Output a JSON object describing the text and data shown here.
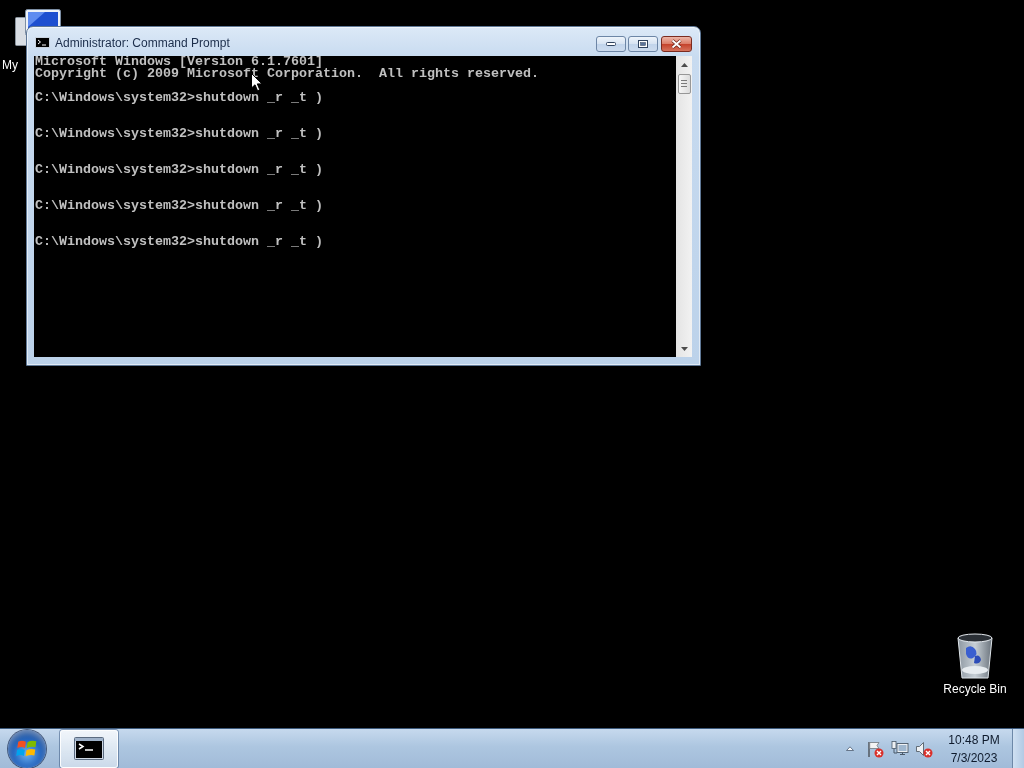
{
  "desktop": {
    "computer_icon": {
      "label": "My"
    },
    "recycle_bin": {
      "label": "Recycle Bin"
    }
  },
  "window": {
    "title": "Administrator: Command Prompt",
    "banner": [
      "Microsoft Windows [Version 6.1.7601]",
      "Copyright (c) 2009 Microsoft Corporation.  All rights reserved."
    ],
    "commands": [
      "C:\\Windows\\system32>shutdown _r _t )",
      "C:\\Windows\\system32>shutdown _r _t )",
      "C:\\Windows\\system32>shutdown _r _t )",
      "C:\\Windows\\system32>shutdown _r _t )",
      "C:\\Windows\\system32>shutdown _r _t )"
    ]
  },
  "taskbar": {
    "buttons": [
      {
        "kind": "console",
        "selected": true
      }
    ],
    "clock": {
      "time": "10:48 PM",
      "date": "7/3/2023"
    }
  }
}
